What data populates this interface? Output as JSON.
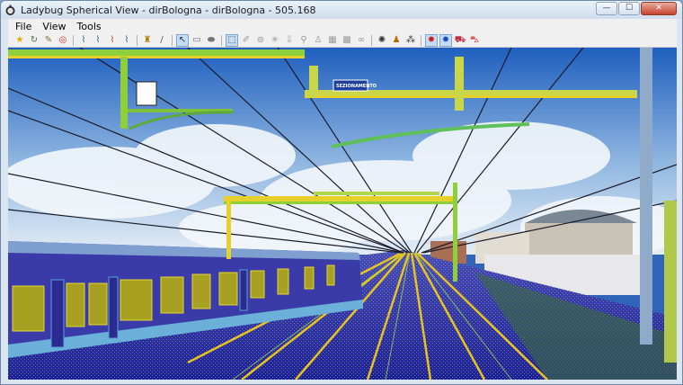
{
  "window": {
    "title": "Ladybug Spherical View - dirBologna - dirBologna - 505.168",
    "minimize_label": "—",
    "maximize_label": "☐",
    "close_label": "✕"
  },
  "menu": {
    "file": "File",
    "view": "View",
    "tools": "Tools"
  },
  "toolbar": {
    "icons": [
      "star-icon",
      "refresh-icon",
      "pencil-icon",
      "circle-icon",
      "road-icon",
      "road-icon",
      "road-icon",
      "road-icon",
      "figure-icon",
      "line-icon",
      "cursor-icon",
      "rect-icon",
      "eraser-icon",
      "select-icon",
      "pen-icon",
      "target-icon",
      "asterisk-icon",
      "arrow-down-icon",
      "pin-icon",
      "person-icon",
      "grid-icon",
      "grid-icon",
      "link-icon",
      "sun-icon",
      "people-icon",
      "footprint-icon",
      "red-star-icon",
      "blue-star-icon",
      "cart-icon",
      "car-icon"
    ]
  },
  "scene": {
    "sign_text": "SEZIONAMENTO"
  },
  "colors": {
    "sky_top": "#1f5fbf",
    "sky_bottom": "#dfeaf5",
    "cloud": "#f3f7fb",
    "ground": "#2e2ea6",
    "rail": "#e6c31f",
    "train": "#3a3aa8",
    "pole_green": "#8fcf3a",
    "pole_yellow": "#e7d02a"
  }
}
